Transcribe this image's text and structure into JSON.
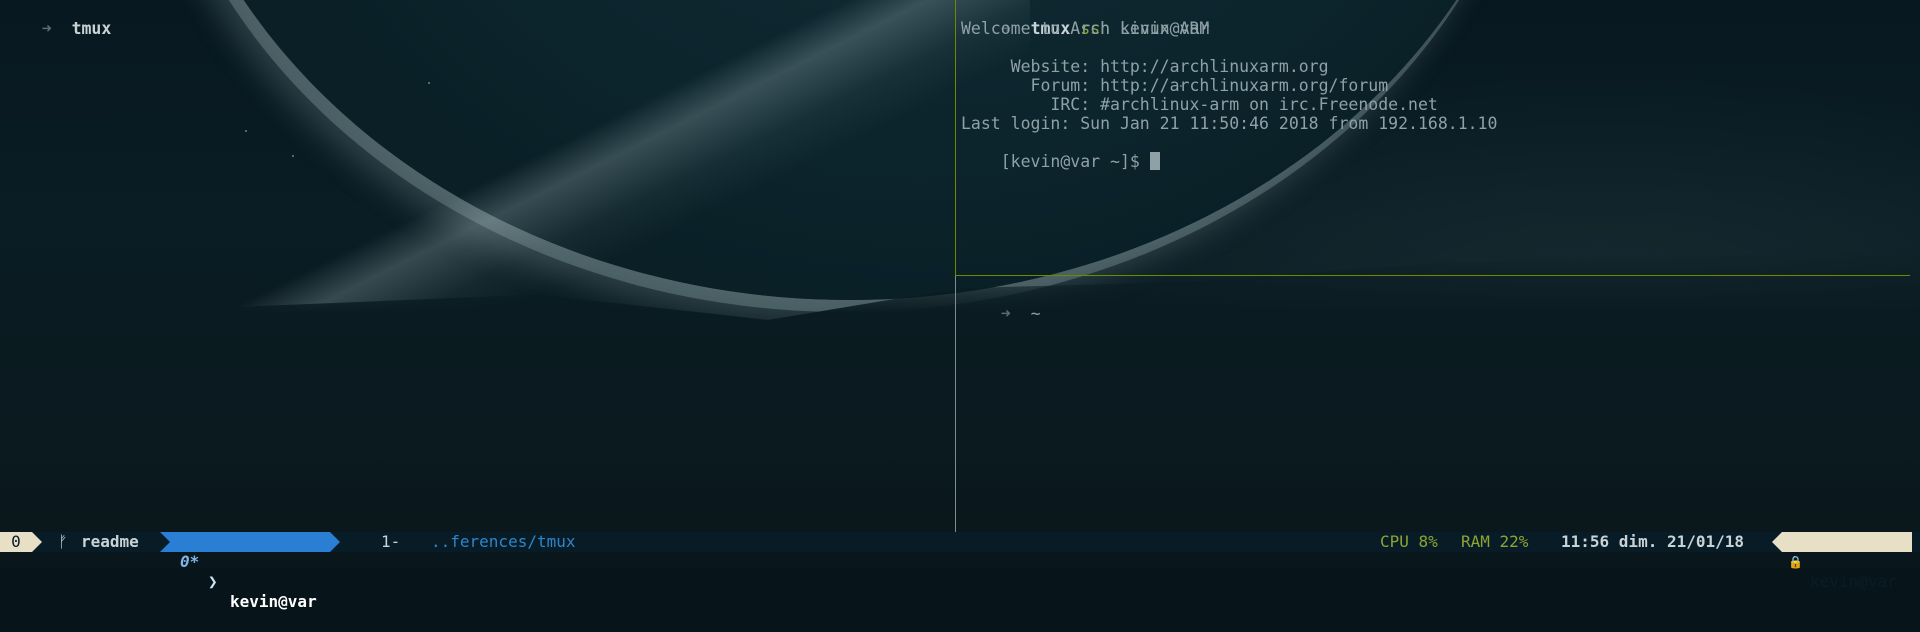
{
  "left_pane": {
    "prompt_symbol": "➜",
    "title": "tmux"
  },
  "right_top_pane": {
    "prompt_symbol": "➜",
    "title": "tmux",
    "command": "ssh",
    "argument": "kevin@var",
    "output": [
      "Welcome to Arch Linux ARM",
      "",
      "     Website: http://archlinuxarm.org",
      "       Forum: http://archlinuxarm.org/forum",
      "         IRC: #archlinux-arm on irc.Freenode.net",
      "Last login: Sun Jan 21 11:50:46 2018 from 192.168.1.10"
    ],
    "remote_prompt": "[kevin@var ~]$ "
  },
  "right_bottom_pane": {
    "prompt_symbol": "➜",
    "cwd": "~"
  },
  "status_bar": {
    "session": "0",
    "branch_icon": "ᚠ",
    "branch": "readme",
    "window_0_index": "0*",
    "window_0_name": "kevin@var",
    "window_1_index": "1-",
    "window_1_path": "..ferences/tmux",
    "cpu": "CPU 8%",
    "ram": "RAM 22%",
    "datetime": "11:56 dim. 21/01/18",
    "lock_icon": "🔒",
    "host": "kevin@var"
  },
  "colors": {
    "accent_green": "#8fa331",
    "window_active": "#2a7fd4",
    "status_bg": "#081c28",
    "cream": "#e7dfc6"
  }
}
